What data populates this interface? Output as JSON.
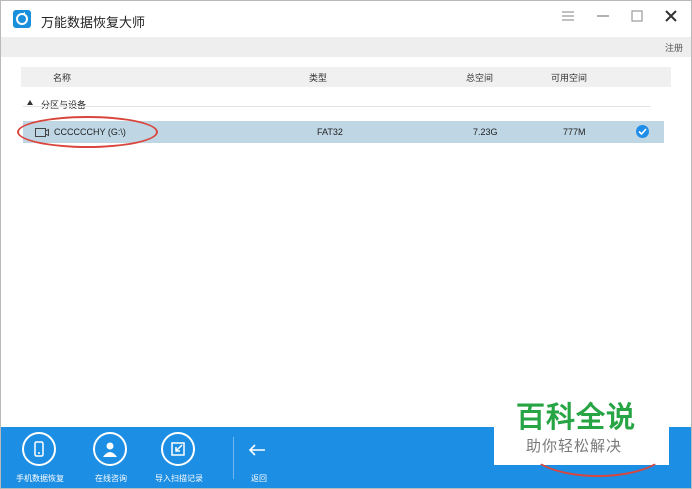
{
  "window": {
    "title": "万能数据恢复大师",
    "register_label": "注册"
  },
  "table": {
    "headers": {
      "name": "名称",
      "type": "类型",
      "total": "总空间",
      "free": "可用空间"
    },
    "group_label": "分区与设备",
    "rows": [
      {
        "name": "CCCCCCHY (G:\\)",
        "type": "FAT32",
        "total": "7.23G",
        "free": "777M",
        "selected": true
      }
    ]
  },
  "toolbar": {
    "items": [
      {
        "label": "手机数据恢复",
        "icon": "phone-icon"
      },
      {
        "label": "在线咨询",
        "icon": "person-icon"
      },
      {
        "label": "导入扫描记录",
        "icon": "import-icon"
      }
    ],
    "back_label": "返回"
  },
  "watermark": {
    "title": "百科全说",
    "subtitle": "助你轻松解决"
  },
  "colors": {
    "accent": "#1c8ee3",
    "selected_row": "#bfd6e4",
    "annotation": "#d9463d",
    "watermark_green": "#27a444"
  }
}
